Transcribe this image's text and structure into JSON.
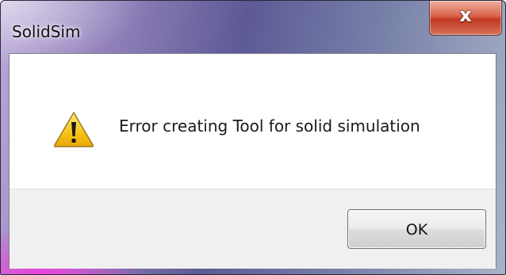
{
  "window": {
    "title": "SolidSim",
    "close_label": "x"
  },
  "dialog": {
    "icon": "warning-icon",
    "message": "Error creating Tool for solid simulation",
    "ok_label": "OK"
  },
  "colors": {
    "close_button": "#c9472d",
    "warning_fill": "#f7c315",
    "content_bg": "#ffffff",
    "footer_bg": "#f0f0f0"
  }
}
